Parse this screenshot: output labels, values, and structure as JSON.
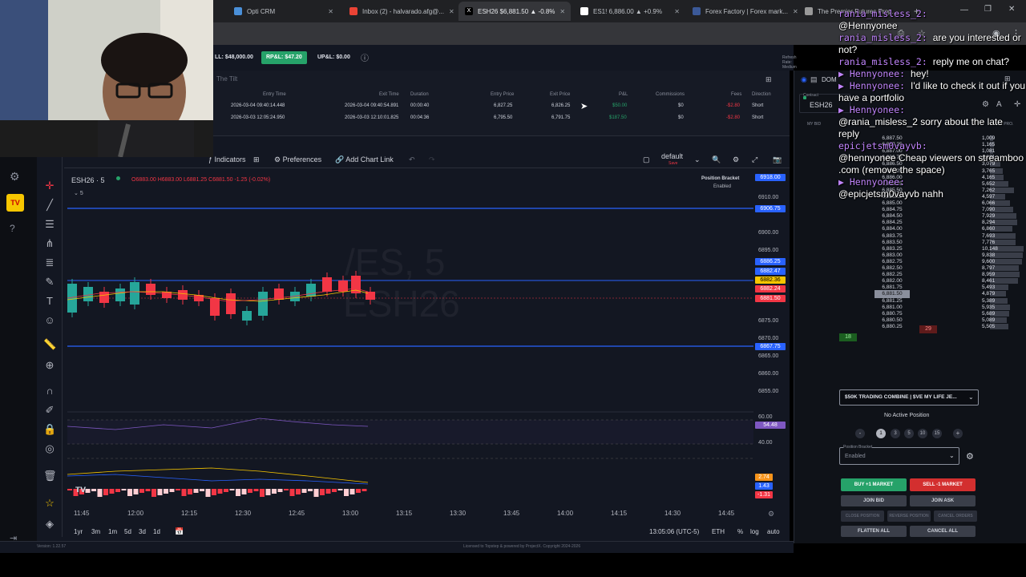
{
  "browser": {
    "tabs": [
      {
        "title": "Opti CRM",
        "active": false
      },
      {
        "title": "Inbox (2) - halvarado.afg@...",
        "active": false
      },
      {
        "title": "ESH26 $6,881.50 ▲ -0.8%",
        "active": true
      },
      {
        "title": "ES1! 6,886.00 ▲ +0.9%",
        "active": false
      },
      {
        "title": "Forex Factory | Forex mark...",
        "active": false
      },
      {
        "title": "The Premier Futures Prop...",
        "active": false
      }
    ]
  },
  "account": {
    "total_pl": "LL: $48,000.00",
    "rp_pl": "RP&L: $47.20",
    "up_pl": "UP&L: $0.00",
    "refresh_label": "Refresh Rate: Medium",
    "tilt_tab": "The Tilt"
  },
  "trades": {
    "headers": [
      "Entry Time",
      "Exit Time",
      "Duration",
      "Entry Price",
      "Exit Price",
      "P&L",
      "Commissions",
      "Fees",
      "Direction"
    ],
    "rows": [
      [
        "2026-03-04 09:40:14.448",
        "2026-03-04 09:40:54.891",
        "00:00:40",
        "6,827.25",
        "6,826.25",
        "$50.00",
        "$0",
        "-$2.80",
        "Short"
      ],
      [
        "2026-03-03 12:05:24.950",
        "2026-03-03 12:10:01.825",
        "00:04:36",
        "6,795.50",
        "6,791.75",
        "$187.50",
        "$0",
        "-$2.80",
        "Short"
      ]
    ]
  },
  "chart": {
    "toolbar": {
      "indicators": "Indicators",
      "preferences": "Preferences",
      "add_chart_link": "Add Chart Link",
      "layout": "default",
      "layout_sub": "Save"
    },
    "symbol": "ESH26 · 5",
    "ohlc": "O6883.00 H6883.00 L6881.25 C6881.50 -1.25 (-0.02%)",
    "interval_badge": "5",
    "watermark_1": "/ES, 5",
    "watermark_2": "ESH26",
    "bracket_title": "Position Bracket",
    "bracket_state": "Enabled",
    "price_ticks": [
      "6910.00",
      "6900.00",
      "6895.00",
      "6875.00",
      "6870.00",
      "6865.00",
      "6860.00",
      "6855.00"
    ],
    "price_labels": [
      {
        "text": "6918.00",
        "color": "#2962ff"
      },
      {
        "text": "6906.75",
        "color": "#2962ff"
      },
      {
        "text": "6886.25",
        "color": "#2962ff"
      },
      {
        "text": "6882.47",
        "color": "#2962ff"
      },
      {
        "text": "6882.36",
        "color": "#f7c600"
      },
      {
        "text": "6882.24",
        "color": "#f23645"
      },
      {
        "text": "6881.50",
        "color": "#f23645"
      },
      {
        "text": "6867.75",
        "color": "#2962ff"
      }
    ],
    "rsi_ticks": [
      "60.00",
      "40.00"
    ],
    "rsi_value": "54.48",
    "macd_values": [
      "2.74",
      "1.43",
      "-1.31"
    ],
    "time_ticks": [
      "11:45",
      "12:00",
      "12:15",
      "12:30",
      "12:45",
      "13:00",
      "13:15",
      "13:30",
      "13:45",
      "14:00",
      "14:15",
      "14:30",
      "14:45"
    ],
    "ranges": [
      "1yr",
      "3m",
      "1m",
      "5d",
      "3d",
      "1d"
    ],
    "clock": "13:05:06 (UTC-5)",
    "session": "ETH",
    "pct": "%",
    "log": "log",
    "auto": "auto",
    "version": "Version: 1.22.57",
    "license": "Licensed to Topstep & powered by ProjectX. Copyright 2024-2026"
  },
  "dom": {
    "tab": "DOM",
    "contract_label": "Contract",
    "contract": "ESH26",
    "headers": [
      "MY BID",
      "BID",
      "PRICE",
      "ASK",
      "MY ASK",
      "VOL PRO."
    ],
    "ladder": [
      {
        "price": "6,887.50",
        "vol": "1,009"
      },
      {
        "price": "6,887.25",
        "vol": "1,165"
      },
      {
        "price": "6,887.00",
        "vol": "1,081"
      },
      {
        "price": "6,886.75",
        "vol": "1,281"
      },
      {
        "price": "6,886.50",
        "vol": "3,079"
      },
      {
        "price": "6,886.25",
        "vol": "3,765"
      },
      {
        "price": "6,886.00",
        "vol": "4,165"
      },
      {
        "price": "6,885.75",
        "vol": "5,652"
      },
      {
        "price": "6,885.50",
        "vol": "7,262"
      },
      {
        "price": "6,885.25",
        "vol": "4,597"
      },
      {
        "price": "6,885.00",
        "vol": "6,066"
      },
      {
        "price": "6,884.75",
        "vol": "7,090"
      },
      {
        "price": "6,884.50",
        "vol": "7,929"
      },
      {
        "price": "6,884.25",
        "vol": "8,294"
      },
      {
        "price": "6,884.00",
        "vol": "6,860"
      },
      {
        "price": "6,883.75",
        "vol": "7,693"
      },
      {
        "price": "6,883.50",
        "vol": "7,776"
      },
      {
        "price": "6,883.25",
        "vol": "10,148"
      },
      {
        "price": "6,883.00",
        "vol": "9,838"
      },
      {
        "price": "6,882.75",
        "vol": "9,600"
      },
      {
        "price": "6,882.50",
        "vol": "8,797"
      },
      {
        "price": "6,882.25",
        "vol": "8,959"
      },
      {
        "price": "6,882.00",
        "vol": "8,461"
      },
      {
        "price": "6,881.75",
        "vol": "5,493"
      },
      {
        "price": "6,881.50",
        "vol": "4,879"
      },
      {
        "price": "6,881.25",
        "vol": "5,389"
      },
      {
        "price": "6,881.00",
        "vol": "5,935"
      },
      {
        "price": "6,880.75",
        "vol": "5,689"
      },
      {
        "price": "6,880.50",
        "vol": "5,089"
      },
      {
        "price": "6,880.25",
        "vol": "5,505"
      }
    ],
    "bid_size": "18",
    "ask_size": "29",
    "account_select": "$50K TRADING COMBINE | $VE MY LIFE JE...",
    "no_position": "No Active Position",
    "qty_options": [
      "1",
      "3",
      "5",
      "10",
      "15"
    ],
    "bracket_label": "Position Bracket",
    "bracket_value": "Enabled",
    "buy_market": "BUY +1 MARKET",
    "sell_market": "SELL -1 MARKET",
    "join_bid": "JOIN BID",
    "join_ask": "JOIN ASK",
    "close_position": "CLOSE POSITION",
    "reverse_position": "REVERSE POSITION",
    "cancel_orders": "CANCEL ORDERS",
    "flatten_all": "FLATTEN ALL",
    "cancel_all": "CANCEL ALL"
  },
  "chat": [
    {
      "name": "rania_misless_2:",
      "text": ""
    },
    {
      "name": "",
      "text": "@Hennyonee"
    },
    {
      "name": "rania_misless_2:",
      "text": "are you interested or not?"
    },
    {
      "name": "rania_misless_2:",
      "text": "reply me on chat?"
    },
    {
      "name": "Hennyonee:",
      "text": "hey!"
    },
    {
      "name": "Hennyonee:",
      "text": "I'd like to check it out if you have a portfolio"
    },
    {
      "name": "Hennyonee:",
      "text": ""
    },
    {
      "name": "",
      "text": "@rania_misless_2 sorry about the late reply"
    },
    {
      "name": "epicjetsm0vayvb:",
      "text": ""
    },
    {
      "name": "",
      "text": "@hennyonee Cheap viewers on streamboo .com (remove the space)"
    },
    {
      "name": "Hennyonee:",
      "text": ""
    },
    {
      "name": "",
      "text": "@epicjetsm0vayvb nahh"
    }
  ]
}
